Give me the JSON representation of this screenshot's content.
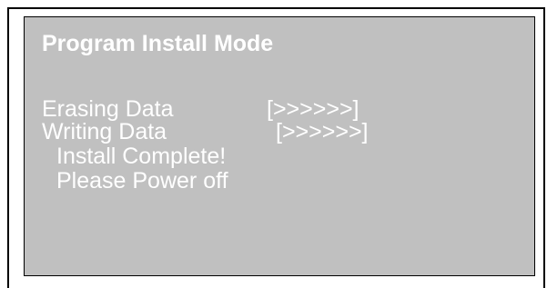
{
  "screen": {
    "title": "Program Install Mode",
    "erasing_label": "Erasing Data",
    "erasing_progress": "[>>>>>>]",
    "writing_label": "Writing Data",
    "writing_progress": "[>>>>>>]",
    "complete_message": "Install Complete!",
    "power_message": "Please Power off"
  },
  "colors": {
    "screen_background": "#c0c0c0",
    "text": "#ffffff",
    "border": "#000000"
  }
}
